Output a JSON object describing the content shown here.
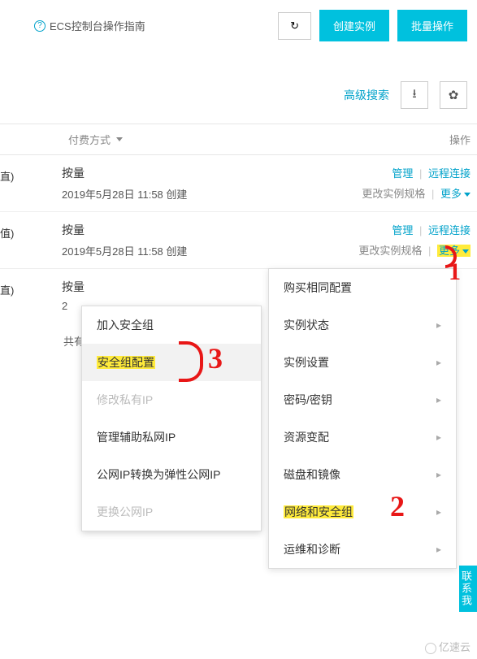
{
  "topbar": {
    "guide_label": "ECS控制台操作指南",
    "refresh_icon": "↻",
    "create_label": "创建实例",
    "batch_label": "批量操作"
  },
  "filter": {
    "adv_search": "高级搜索",
    "export_icon": "⭳",
    "settings_icon": "✿"
  },
  "header": {
    "pay_col": "付费方式",
    "ops_col": "操作"
  },
  "rows": [
    {
      "marker": "直)",
      "billing": "按量",
      "created": "2019年5月28日 11:58 创建",
      "manage": "管理",
      "remote": "远程连接",
      "spec": "更改实例规格",
      "more": "更多",
      "highlight_more": false
    },
    {
      "marker": "值)",
      "billing": "按量",
      "created": "2019年5月28日 11:58 创建",
      "manage": "管理",
      "remote": "远程连接",
      "spec": "更改实例规格",
      "more": "更多",
      "highlight_more": true
    },
    {
      "marker": "直)",
      "billing": "按量",
      "created": "2",
      "manage": "",
      "remote": "",
      "spec": "",
      "more": "",
      "highlight_more": false
    }
  ],
  "footer": {
    "share_label": "共有"
  },
  "menu1": {
    "items": [
      {
        "label": "购买相同配置",
        "sub": false,
        "hl": false
      },
      {
        "label": "实例状态",
        "sub": true,
        "hl": false
      },
      {
        "label": "实例设置",
        "sub": true,
        "hl": false
      },
      {
        "label": "密码/密钥",
        "sub": true,
        "hl": false
      },
      {
        "label": "资源变配",
        "sub": true,
        "hl": false
      },
      {
        "label": "磁盘和镜像",
        "sub": true,
        "hl": false
      },
      {
        "label": "网络和安全组",
        "sub": true,
        "hl": true
      },
      {
        "label": "运维和诊断",
        "sub": true,
        "hl": false
      }
    ]
  },
  "menu2": {
    "items": [
      {
        "label": "加入安全组",
        "state": ""
      },
      {
        "label": "安全组配置",
        "state": "active hl"
      },
      {
        "label": "修改私有IP",
        "state": "disabled"
      },
      {
        "label": "管理辅助私网IP",
        "state": ""
      },
      {
        "label": "公网IP转换为弹性公网IP",
        "state": ""
      },
      {
        "label": "更换公网IP",
        "state": "disabled"
      }
    ]
  },
  "annotations": {
    "one": "1",
    "two": "2",
    "three": "3"
  },
  "sidetab": {
    "label": "联系我"
  },
  "watermark": {
    "label": "亿速云"
  }
}
